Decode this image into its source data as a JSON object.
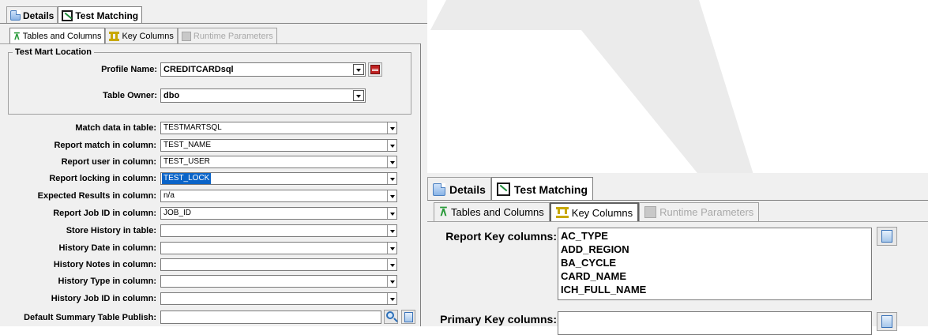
{
  "left_panel": {
    "tabs": [
      {
        "label": "Details",
        "icon": "details-icon",
        "active": false
      },
      {
        "label": "Test Matching",
        "icon": "test-matching-icon",
        "active": true
      }
    ],
    "subtabs": [
      {
        "label": "Tables and Columns",
        "icon": "tables-icon",
        "active": true,
        "enabled": true
      },
      {
        "label": "Key Columns",
        "icon": "key-icon",
        "active": false,
        "enabled": true
      },
      {
        "label": "Runtime Parameters",
        "icon": "runtime-icon",
        "active": false,
        "enabled": false
      }
    ],
    "test_mart_location": {
      "legend": "Test Mart Location",
      "profile_name_label": "Profile Name:",
      "profile_name_value": "CREDITCARDsql",
      "table_owner_label": "Table Owner:",
      "table_owner_value": "dbo"
    },
    "fields": [
      {
        "label": "Match data in table:",
        "value": "TESTMARTSQL",
        "selected": false
      },
      {
        "label": "Report match in column:",
        "value": "TEST_NAME",
        "selected": false
      },
      {
        "label": "Report user in column:",
        "value": "TEST_USER",
        "selected": false
      },
      {
        "label": "Report locking in column:",
        "value": "TEST_LOCK",
        "selected": true
      },
      {
        "label": "Expected Results in column:",
        "value": "n/a",
        "selected": false
      },
      {
        "label": "Report Job ID in column:",
        "value": "JOB_ID",
        "selected": false
      },
      {
        "label": "Store History in table:",
        "value": "",
        "selected": false
      },
      {
        "label": "History Date in column:",
        "value": "",
        "selected": false
      },
      {
        "label": "History Notes in column:",
        "value": "",
        "selected": false
      },
      {
        "label": "History Type in column:",
        "value": "",
        "selected": false
      },
      {
        "label": "History Job ID in column:",
        "value": "",
        "selected": false
      }
    ],
    "default_summary": {
      "label": "Default Summary Table Publish:",
      "value": ""
    }
  },
  "right_panel": {
    "tabs": [
      {
        "label": "Details",
        "icon": "details-icon",
        "active": false
      },
      {
        "label": "Test Matching",
        "icon": "test-matching-icon",
        "active": true
      }
    ],
    "subtabs": [
      {
        "label": "Tables and Columns",
        "icon": "tables-icon",
        "active": false,
        "enabled": true
      },
      {
        "label": "Key Columns",
        "icon": "key-icon",
        "active": true,
        "enabled": true
      },
      {
        "label": "Runtime Parameters",
        "icon": "runtime-icon",
        "active": false,
        "enabled": false
      }
    ],
    "report_key_label": "Report Key columns:",
    "report_key_columns": [
      "AC_TYPE",
      "ADD_REGION",
      "BA_CYCLE",
      "CARD_NAME",
      "ICH_FULL_NAME"
    ],
    "primary_key_label": "Primary Key columns:"
  },
  "colors": {
    "selection": "#0a64c8",
    "panel_bg": "#f0f0f0",
    "hammer_shape": "#ebebeb"
  }
}
